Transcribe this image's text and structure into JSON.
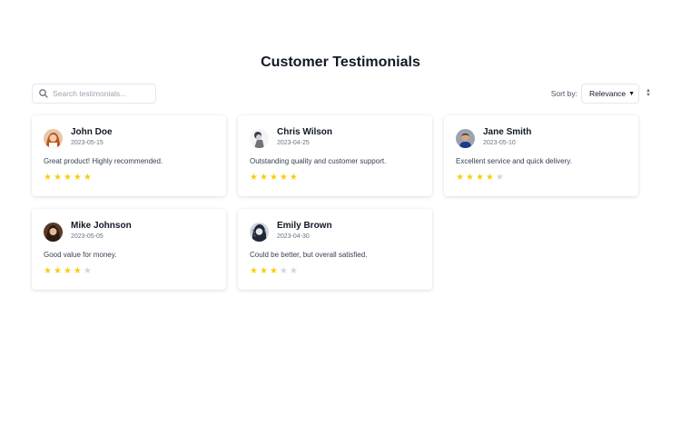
{
  "page": {
    "title": "Customer Testimonials"
  },
  "search": {
    "placeholder": "Search testimonials..."
  },
  "sort": {
    "label": "Sort by:",
    "selected": "Relevance"
  },
  "colors": {
    "star_filled": "#facc15",
    "star_empty": "#d1d5db"
  },
  "testimonials": [
    {
      "name": "John Doe",
      "date": "2023-05-15",
      "text": "Great product! Highly recommended.",
      "rating": 5,
      "max_rating": 5
    },
    {
      "name": "Chris Wilson",
      "date": "2023-04-25",
      "text": "Outstanding quality and customer support.",
      "rating": 5,
      "max_rating": 5
    },
    {
      "name": "Jane Smith",
      "date": "2023-05-10",
      "text": "Excellent service and quick delivery.",
      "rating": 4,
      "max_rating": 5
    },
    {
      "name": "Mike Johnson",
      "date": "2023-05-05",
      "text": "Good value for money.",
      "rating": 4,
      "max_rating": 5
    },
    {
      "name": "Emily Brown",
      "date": "2023-04-30",
      "text": "Could be better, but overall satisfied.",
      "rating": 3,
      "max_rating": 5
    }
  ]
}
